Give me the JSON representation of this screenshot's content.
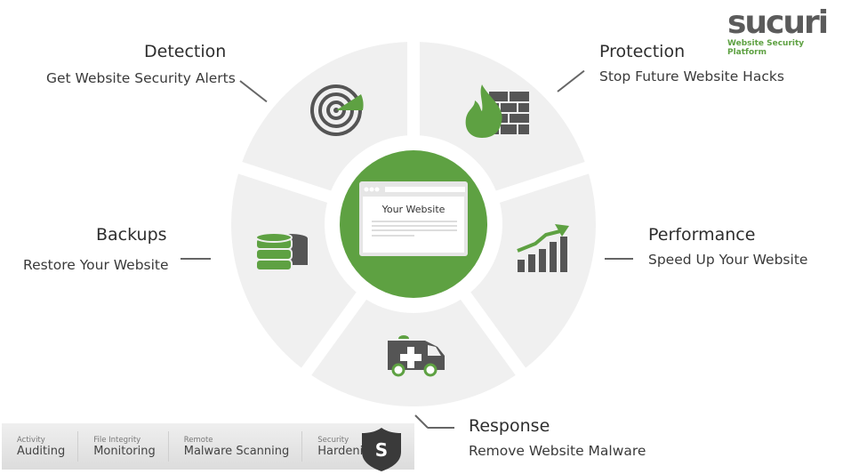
{
  "logo": {
    "wordmark": "sucuri",
    "tagline": "Website Security Platform"
  },
  "center": {
    "label": "Your Website"
  },
  "segments": [
    {
      "id": "detection",
      "title": "Detection",
      "subtitle": "Get Website Security Alerts",
      "icon": "radar-target-icon"
    },
    {
      "id": "protection",
      "title": "Protection",
      "subtitle": "Stop Future Website Hacks",
      "icon": "firewall-icon"
    },
    {
      "id": "backups",
      "title": "Backups",
      "subtitle": "Restore Your Website",
      "icon": "database-icon"
    },
    {
      "id": "performance",
      "title": "Performance",
      "subtitle": "Speed Up Your Website",
      "icon": "growth-chart-icon"
    },
    {
      "id": "response",
      "title": "Response",
      "subtitle": "Remove Website Malware",
      "icon": "ambulance-icon"
    }
  ],
  "bottom_bar": {
    "items": [
      {
        "small": "Activity",
        "main": "Auditing"
      },
      {
        "small": "File Integrity",
        "main": "Monitoring"
      },
      {
        "small": "Remote",
        "main": "Malware Scanning"
      },
      {
        "small": "Security",
        "main": "Hardening"
      }
    ],
    "shield_letter": "S"
  },
  "colors": {
    "green": "#5ea142",
    "segment": "#f0f0f0",
    "icon": "#555555"
  }
}
